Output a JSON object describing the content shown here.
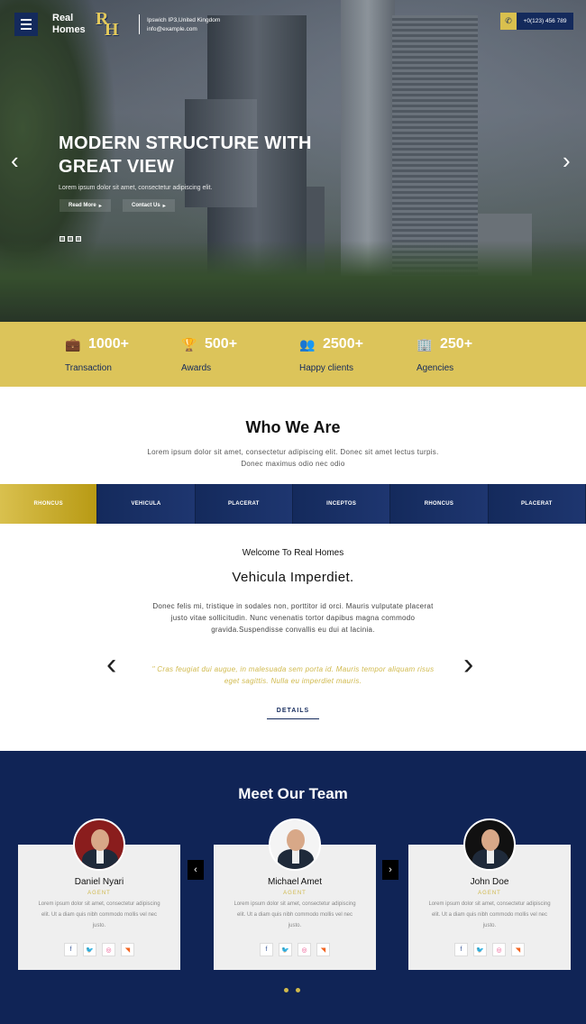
{
  "header": {
    "brand": "Real\nHomes",
    "brand_line1": "Real",
    "brand_line2": "Homes",
    "logo_r": "R",
    "logo_h": "H",
    "address": "Ipswich IP3,United Kingdom",
    "email": "info@example.com",
    "phone": "+0(123) 456 789"
  },
  "hero": {
    "title_line1": "MODERN STRUCTURE WITH",
    "title_line2": "GREAT VIEW",
    "subtitle": "Lorem ipsum dolor sit amet, consectetur adipiscing elit.",
    "btn_read": "Read More",
    "btn_contact": "Contact Us",
    "arrow_prev": "‹",
    "arrow_next": "›"
  },
  "stats": [
    {
      "num": "1000+",
      "label": "Transaction",
      "icon": "briefcase-icon"
    },
    {
      "num": "500+",
      "label": "Awards",
      "icon": "trophy-icon"
    },
    {
      "num": "2500+",
      "label": "Happy clients",
      "icon": "users-icon"
    },
    {
      "num": "250+",
      "label": "Agencies",
      "icon": "building-icon"
    }
  ],
  "who": {
    "title": "Who We Are",
    "text": "Lorem ipsum dolor sit amet, consectetur adipiscing elit. Donec sit amet lectus turpis. Donec maximus odio nec odio"
  },
  "tabs": [
    "RHONCUS",
    "VEHICULA",
    "PLACERAT",
    "INCEPTOS",
    "RHONCUS",
    "PLACERAT"
  ],
  "welcome": {
    "subtitle": "Welcome To Real Homes",
    "title": "Vehicula Imperdiet.",
    "text": "Donec felis mi, tristique in sodales non, porttitor id orci. Mauris vulputate placerat justo vitae sollicitudin. Nunc venenatis tortor dapibus magna commodo gravida.Suspendisse convallis eu dui at lacinia.",
    "quote": "\" Cras feugiat dui augue, in malesuada sem porta id. Mauris tempor aliquam risus eget sagittis. Nulla eu imperdiet mauris.",
    "details": "DETAILS"
  },
  "team": {
    "title": "Meet Our Team",
    "members": [
      {
        "name": "Daniel Nyari",
        "role": "AGENT",
        "desc": "Lorem ipsum dolor sit amet, consectetur adipiscing elit. Ut a diam quis nibh commodo mollis vel nec justo."
      },
      {
        "name": "Michael Amet",
        "role": "AGENT",
        "desc": "Lorem ipsum dolor sit amet, consectetur adipiscing elit. Ut a diam quis nibh commodo mollis vel nec justo."
      },
      {
        "name": "John Doe",
        "role": "AGENT",
        "desc": "Lorem ipsum dolor sit amet, consectetur adipiscing elit. Ut a diam quis nibh commodo mollis vel nec justo."
      }
    ]
  },
  "colors": {
    "navy": "#142a5c",
    "gold": "#dcc45a"
  }
}
